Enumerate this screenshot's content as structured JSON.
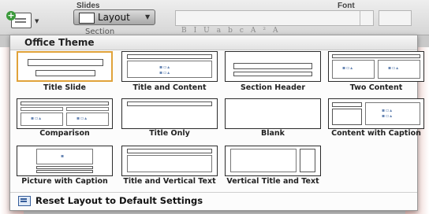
{
  "ribbon": {
    "slides_group": "Slides",
    "font_group": "Font",
    "layout_button": "Layout",
    "section_label": "Section"
  },
  "panel": {
    "title": "Office Theme",
    "layouts": [
      {
        "label": "Title Slide",
        "selected": true
      },
      {
        "label": "Title and Content"
      },
      {
        "label": "Section Header"
      },
      {
        "label": "Two Content"
      },
      {
        "label": "Comparison"
      },
      {
        "label": "Title Only"
      },
      {
        "label": "Blank"
      },
      {
        "label": "Content with Caption"
      },
      {
        "label": "Picture with Caption"
      },
      {
        "label": "Title and Vertical Text"
      },
      {
        "label": "Vertical Title and Text"
      }
    ],
    "reset_label": "Reset Layout to Default Settings"
  },
  "colors": {
    "selected_border": "#e0a23a",
    "ribbon_bg": "#dedede"
  }
}
